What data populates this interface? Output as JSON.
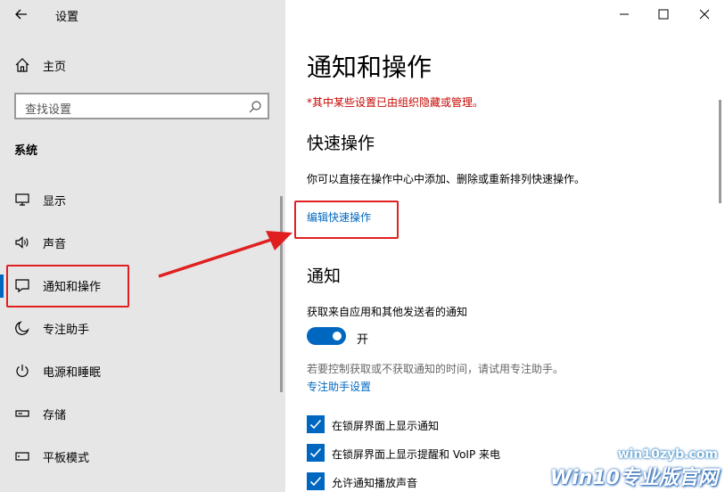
{
  "window": {
    "title": "设置",
    "controls": [
      "minimize-icon",
      "maximize-icon",
      "close-icon"
    ]
  },
  "sidebar": {
    "home": "主页",
    "search_placeholder": "查找设置",
    "section": "系统",
    "items": [
      {
        "label": "显示",
        "icon": "monitor-icon"
      },
      {
        "label": "声音",
        "icon": "speaker-icon"
      },
      {
        "label": "通知和操作",
        "icon": "message-icon",
        "selected": true
      },
      {
        "label": "专注助手",
        "icon": "moon-icon"
      },
      {
        "label": "电源和睡眠",
        "icon": "power-icon"
      },
      {
        "label": "存储",
        "icon": "storage-icon"
      },
      {
        "label": "平板模式",
        "icon": "tablet-icon"
      }
    ]
  },
  "main": {
    "title": "通知和操作",
    "warning": "*其中某些设置已由组织隐藏或管理。",
    "quick_actions": {
      "heading": "快速操作",
      "description": "你可以直接在操作中心中添加、删除或重新排列快速操作。",
      "edit_link": "编辑快速操作"
    },
    "notifications": {
      "heading": "通知",
      "get_notifications_label": "获取来自应用和其他发送者的通知",
      "toggle_state": "开",
      "toggle_on": true,
      "focus_note": "若要控制获取或不获取通知的时间，请试用专注助手。",
      "focus_link": "专注助手设置",
      "checkboxes": [
        {
          "label": "在锁屏界面上显示通知",
          "checked": true
        },
        {
          "label": "在锁屏界面上显示提醒和 VoIP 来电",
          "checked": true
        },
        {
          "label": "允许通知播放声音",
          "checked": true
        }
      ]
    }
  },
  "watermark": {
    "url": "win10zyb.com",
    "brand": "Win10专业版官网"
  },
  "colors": {
    "accent": "#0067c0",
    "warning": "#c50500",
    "annotation": "#e02020",
    "sidebar_bg": "#e6e6e6"
  }
}
